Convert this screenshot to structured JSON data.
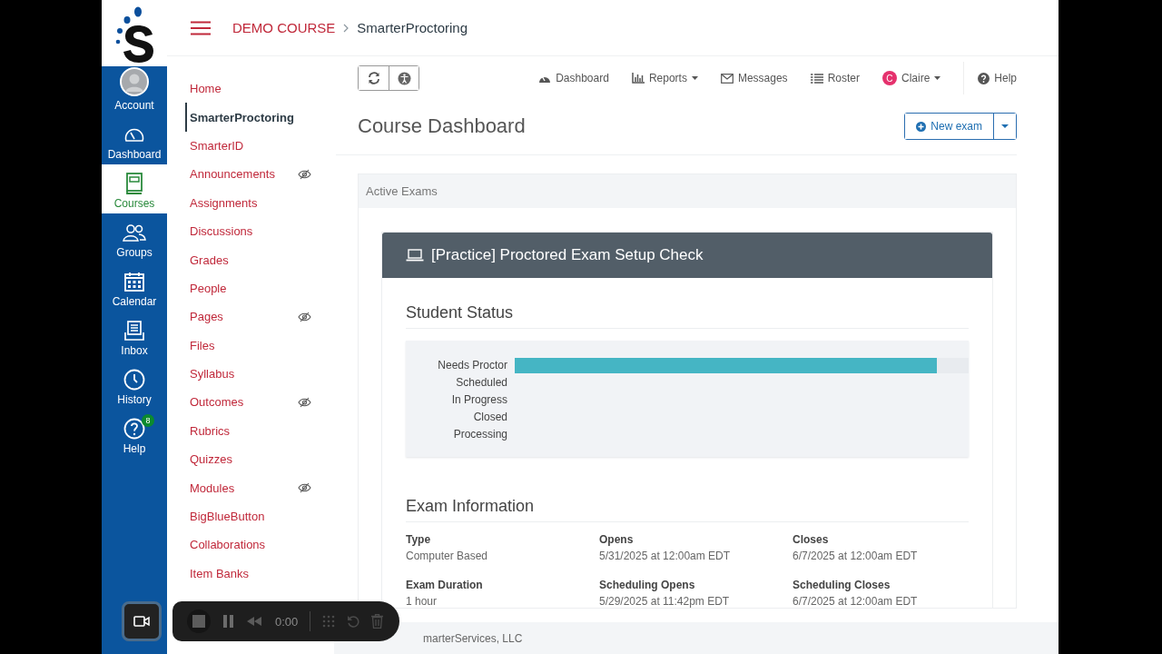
{
  "global_nav": [
    {
      "label": "Account",
      "kind": "avatar",
      "selected": false
    },
    {
      "label": "Dashboard",
      "kind": "gauge",
      "selected": false
    },
    {
      "label": "Courses",
      "kind": "book",
      "selected": true
    },
    {
      "label": "Groups",
      "kind": "people",
      "selected": false
    },
    {
      "label": "Calendar",
      "kind": "calendar",
      "selected": false
    },
    {
      "label": "Inbox",
      "kind": "inbox",
      "selected": false
    },
    {
      "label": "History",
      "kind": "clock",
      "selected": false
    },
    {
      "label": "Help",
      "kind": "help",
      "selected": false,
      "badge": "8"
    }
  ],
  "breadcrumb": [
    "DEMO COURSE",
    "SmarterProctoring"
  ],
  "course_nav": [
    {
      "label": "Home",
      "selected": false,
      "hidden": false
    },
    {
      "label": "SmarterProctoring",
      "selected": true,
      "hidden": false
    },
    {
      "label": "SmarterID",
      "selected": false,
      "hidden": false
    },
    {
      "label": "Announcements",
      "selected": false,
      "hidden": true
    },
    {
      "label": "Assignments",
      "selected": false,
      "hidden": false
    },
    {
      "label": "Discussions",
      "selected": false,
      "hidden": false
    },
    {
      "label": "Grades",
      "selected": false,
      "hidden": false
    },
    {
      "label": "People",
      "selected": false,
      "hidden": false
    },
    {
      "label": "Pages",
      "selected": false,
      "hidden": true
    },
    {
      "label": "Files",
      "selected": false,
      "hidden": false
    },
    {
      "label": "Syllabus",
      "selected": false,
      "hidden": false
    },
    {
      "label": "Outcomes",
      "selected": false,
      "hidden": true
    },
    {
      "label": "Rubrics",
      "selected": false,
      "hidden": false
    },
    {
      "label": "Quizzes",
      "selected": false,
      "hidden": false
    },
    {
      "label": "Modules",
      "selected": false,
      "hidden": true
    },
    {
      "label": "BigBlueButton",
      "selected": false,
      "hidden": false
    },
    {
      "label": "Collaborations",
      "selected": false,
      "hidden": false
    },
    {
      "label": "Item Banks",
      "selected": false,
      "hidden": false
    }
  ],
  "top_nav": [
    {
      "label": "Dashboard",
      "kind": "gauge",
      "dropdown": false
    },
    {
      "label": "Reports",
      "kind": "bars",
      "dropdown": true
    },
    {
      "label": "Messages",
      "kind": "envelope",
      "dropdown": false
    },
    {
      "label": "Roster",
      "kind": "list",
      "dropdown": false
    },
    {
      "label": "Claire",
      "kind": "user",
      "initial": "C",
      "dropdown": true
    },
    {
      "label": "Help",
      "kind": "help",
      "dropdown": false
    }
  ],
  "page_title": "Course Dashboard",
  "new_exam_button": "New exam",
  "active_exams": {
    "title": "Active Exams",
    "exams": [
      {
        "title": "[Practice] Proctored Exam Setup Check",
        "status_heading": "Student Status",
        "statuses": [
          {
            "label": "Needs Proctor",
            "level": 0.93
          },
          {
            "label": "Scheduled"
          },
          {
            "label": "In Progress"
          },
          {
            "label": "Closed"
          },
          {
            "label": "Processing"
          }
        ],
        "info_heading": "Exam Information",
        "info": [
          {
            "label": "Type",
            "value": "Computer Based"
          },
          {
            "label": "Opens",
            "value": "5/31/2025 at 12:00am EDT"
          },
          {
            "label": "Closes",
            "value": "6/7/2025 at 12:00am EDT"
          },
          {
            "label": "Exam Duration",
            "value": "1 hour"
          },
          {
            "label": "Scheduling Opens",
            "value": "5/29/2025 at 11:42pm EDT"
          },
          {
            "label": "Scheduling Closes",
            "value": "6/7/2025 at 12:00am EDT"
          }
        ]
      }
    ]
  },
  "footer": "marterServices, LLC",
  "recorder": {
    "time": "0:00"
  }
}
